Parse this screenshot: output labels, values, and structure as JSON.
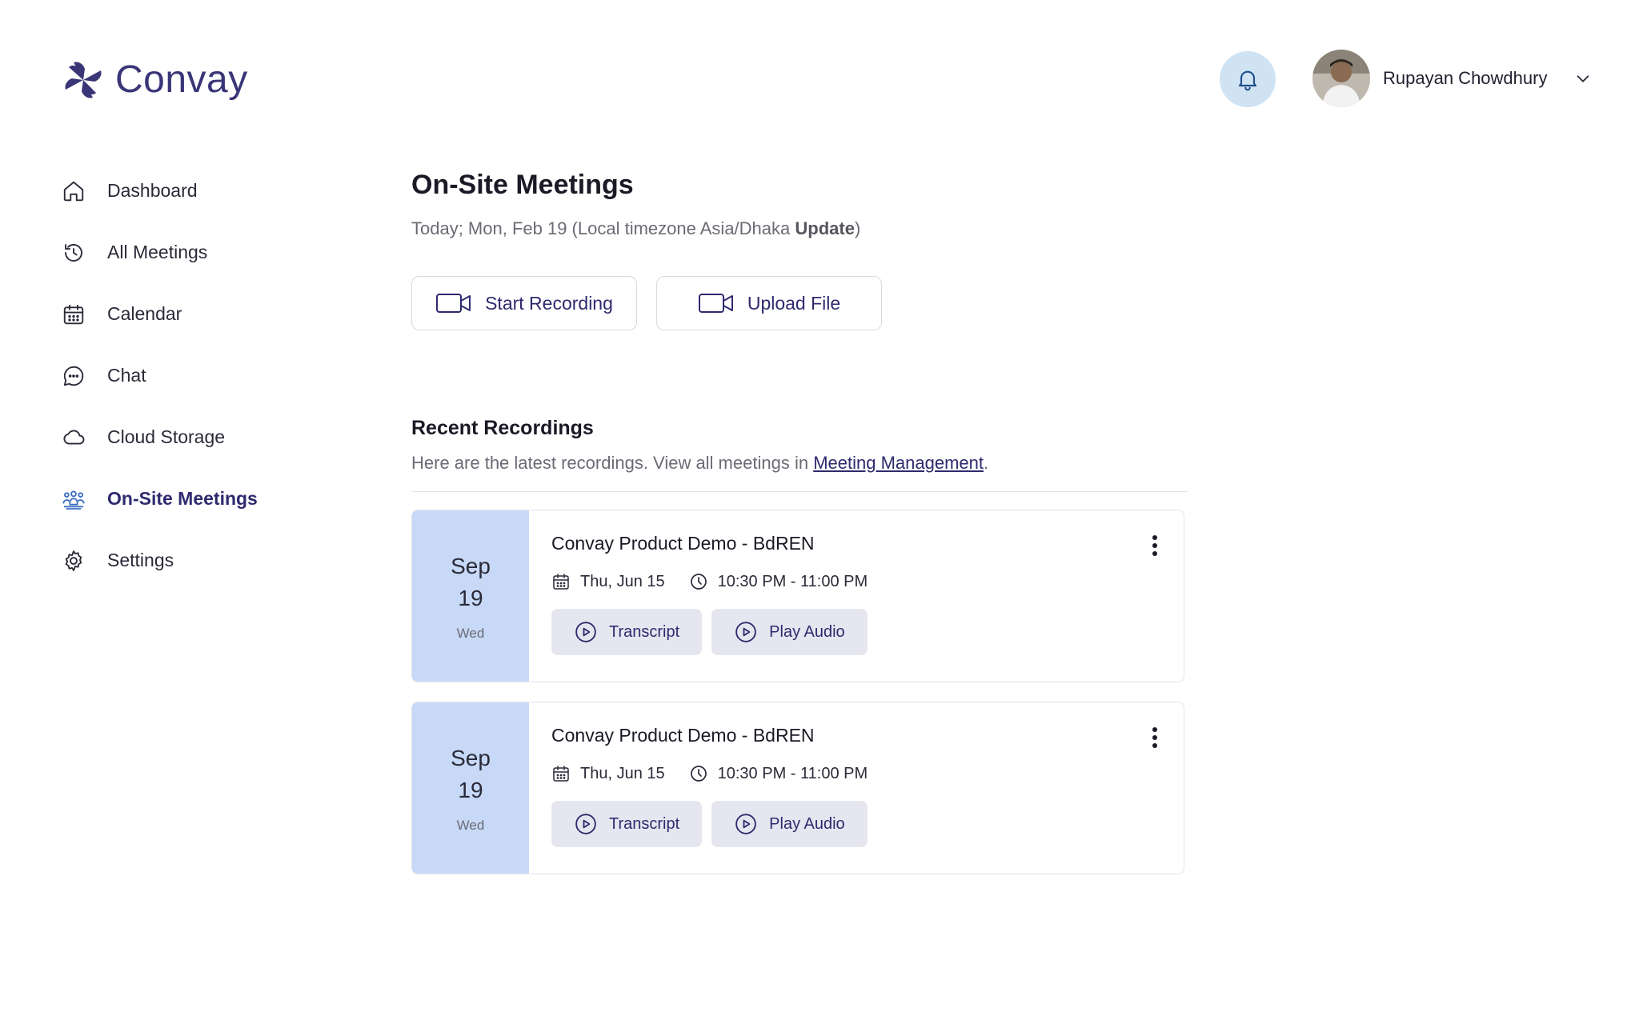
{
  "app": {
    "logo_text": "Convay"
  },
  "header": {
    "notification_icon": "bell-icon",
    "user_name": "Rupayan Chowdhury"
  },
  "sidebar": {
    "items": [
      {
        "label": "Dashboard",
        "icon": "home-icon"
      },
      {
        "label": "All Meetings",
        "icon": "history-icon"
      },
      {
        "label": "Calendar",
        "icon": "calendar-icon"
      },
      {
        "label": "Chat",
        "icon": "chat-icon"
      },
      {
        "label": "Cloud Storage",
        "icon": "cloud-icon"
      },
      {
        "label": "On-Site Meetings",
        "icon": "group-icon",
        "active": true
      },
      {
        "label": "Settings",
        "icon": "gear-icon"
      }
    ]
  },
  "main": {
    "title": "On-Site Meetings",
    "subtitle_prefix": "Today; Mon, Feb 19 (Local timezone Asia/Dhaka ",
    "subtitle_update": "Update",
    "subtitle_suffix": ")",
    "start_recording_label": "Start Recording",
    "upload_file_label": "Upload File",
    "recent": {
      "title": "Recent Recordings",
      "desc_prefix": "Here are the latest recordings. View all meetings in ",
      "link": "Meeting Management",
      "desc_suffix": "."
    },
    "recordings": [
      {
        "month": "Sep",
        "day": "19",
        "weekday": "Wed",
        "title": "Convay Product Demo - BdREN",
        "date": "Thu, Jun 15",
        "time": "10:30 PM - 11:00 PM",
        "transcript_label": "Transcript",
        "play_label": "Play Audio"
      },
      {
        "month": "Sep",
        "day": "19",
        "weekday": "Wed",
        "title": "Convay Product Demo - BdREN",
        "date": "Thu, Jun 15",
        "time": "10:30 PM - 11:00 PM",
        "transcript_label": "Transcript",
        "play_label": "Play Audio"
      }
    ]
  },
  "colors": {
    "brand": "#3a3577",
    "accent_text": "#2f2a6e",
    "date_block": "#c7d9f7",
    "bell_bg": "#cfe3f3",
    "soft_button": "#e6e6f0"
  }
}
